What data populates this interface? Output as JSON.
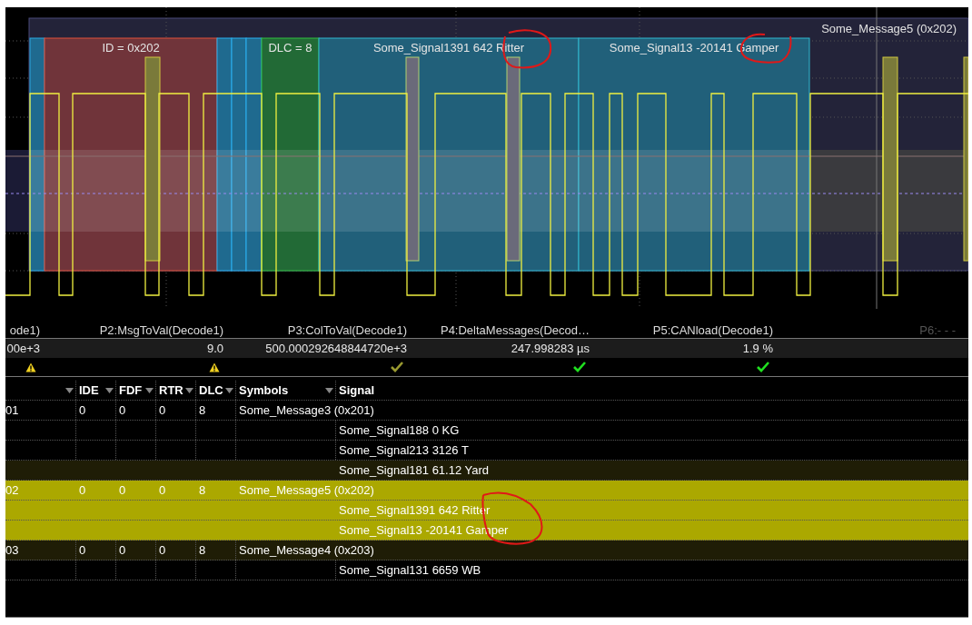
{
  "scope": {
    "message_label": "Some_Message5 (0x202)",
    "fields": [
      {
        "kind": "sof"
      },
      {
        "kind": "id",
        "label": "ID = 0x202"
      },
      {
        "kind": "control"
      },
      {
        "kind": "control"
      },
      {
        "kind": "control"
      },
      {
        "kind": "dlc",
        "label": "DLC = 8"
      },
      {
        "kind": "signal",
        "label": "Some_Signal1391 642 Ritter"
      },
      {
        "kind": "signal",
        "label": "Some_Signal13 -20141 Gamper"
      }
    ]
  },
  "measurements": [
    {
      "header": "ode1)",
      "value": "00e+3",
      "kind": "warning",
      "disabled": false
    },
    {
      "header": "P2:MsgToVal(Decode1)",
      "value": "9.0",
      "kind": "warning",
      "disabled": false
    },
    {
      "header": "P3:ColToVal(Decode1)",
      "value": "500.000292648844720e+3",
      "kind": "check",
      "dim": true,
      "disabled": false
    },
    {
      "header": "P4:DeltaMessages(Decod…",
      "value": "247.998283 µs",
      "kind": "check",
      "dim": false,
      "disabled": false
    },
    {
      "header": "P5:CANload(Decode1)",
      "value": "1.9 %",
      "kind": "check",
      "dim": false,
      "disabled": false
    },
    {
      "header": "P6:- - -",
      "disabled": true
    }
  ],
  "table": {
    "columns": [
      {
        "filter": true
      },
      {
        "label": "IDE",
        "filter": true
      },
      {
        "label": "FDF",
        "filter": true
      },
      {
        "label": "RTR",
        "filter": true
      },
      {
        "label": "DLC",
        "filter": true
      },
      {
        "label": "Symbols",
        "filter": true
      },
      {
        "label": "Signal",
        "filter": false
      }
    ],
    "rows": [
      {
        "kind": "message",
        "cells": [
          "01",
          "0",
          "0",
          "0",
          "8"
        ],
        "symbols": "Some_Message3 (0x201)",
        "selected": false,
        "shaded": false
      },
      {
        "kind": "signal",
        "signal": "Some_Signal188 0 KG",
        "selected": false,
        "shaded": false
      },
      {
        "kind": "signal",
        "signal": "Some_Signal213 3126 T",
        "selected": false,
        "shaded": false
      },
      {
        "kind": "signal",
        "signal": "Some_Signal181 61.12 Yard",
        "selected": false,
        "shaded": true
      },
      {
        "kind": "message",
        "cells": [
          "02",
          "0",
          "0",
          "0",
          "8"
        ],
        "symbols": "Some_Message5 (0x202)",
        "selected": true
      },
      {
        "kind": "signal",
        "signal": "Some_Signal1391 642 Ritter",
        "selected": true
      },
      {
        "kind": "signal",
        "signal": "Some_Signal13 -20141 Gamper",
        "selected": true
      },
      {
        "kind": "message",
        "cells": [
          "03",
          "0",
          "0",
          "0",
          "8"
        ],
        "symbols": "Some_Message4 (0x203)",
        "selected": false,
        "shaded": true
      },
      {
        "kind": "signal",
        "signal": "Some_Signal131 6659 WB",
        "selected": false,
        "shaded": false
      }
    ]
  }
}
